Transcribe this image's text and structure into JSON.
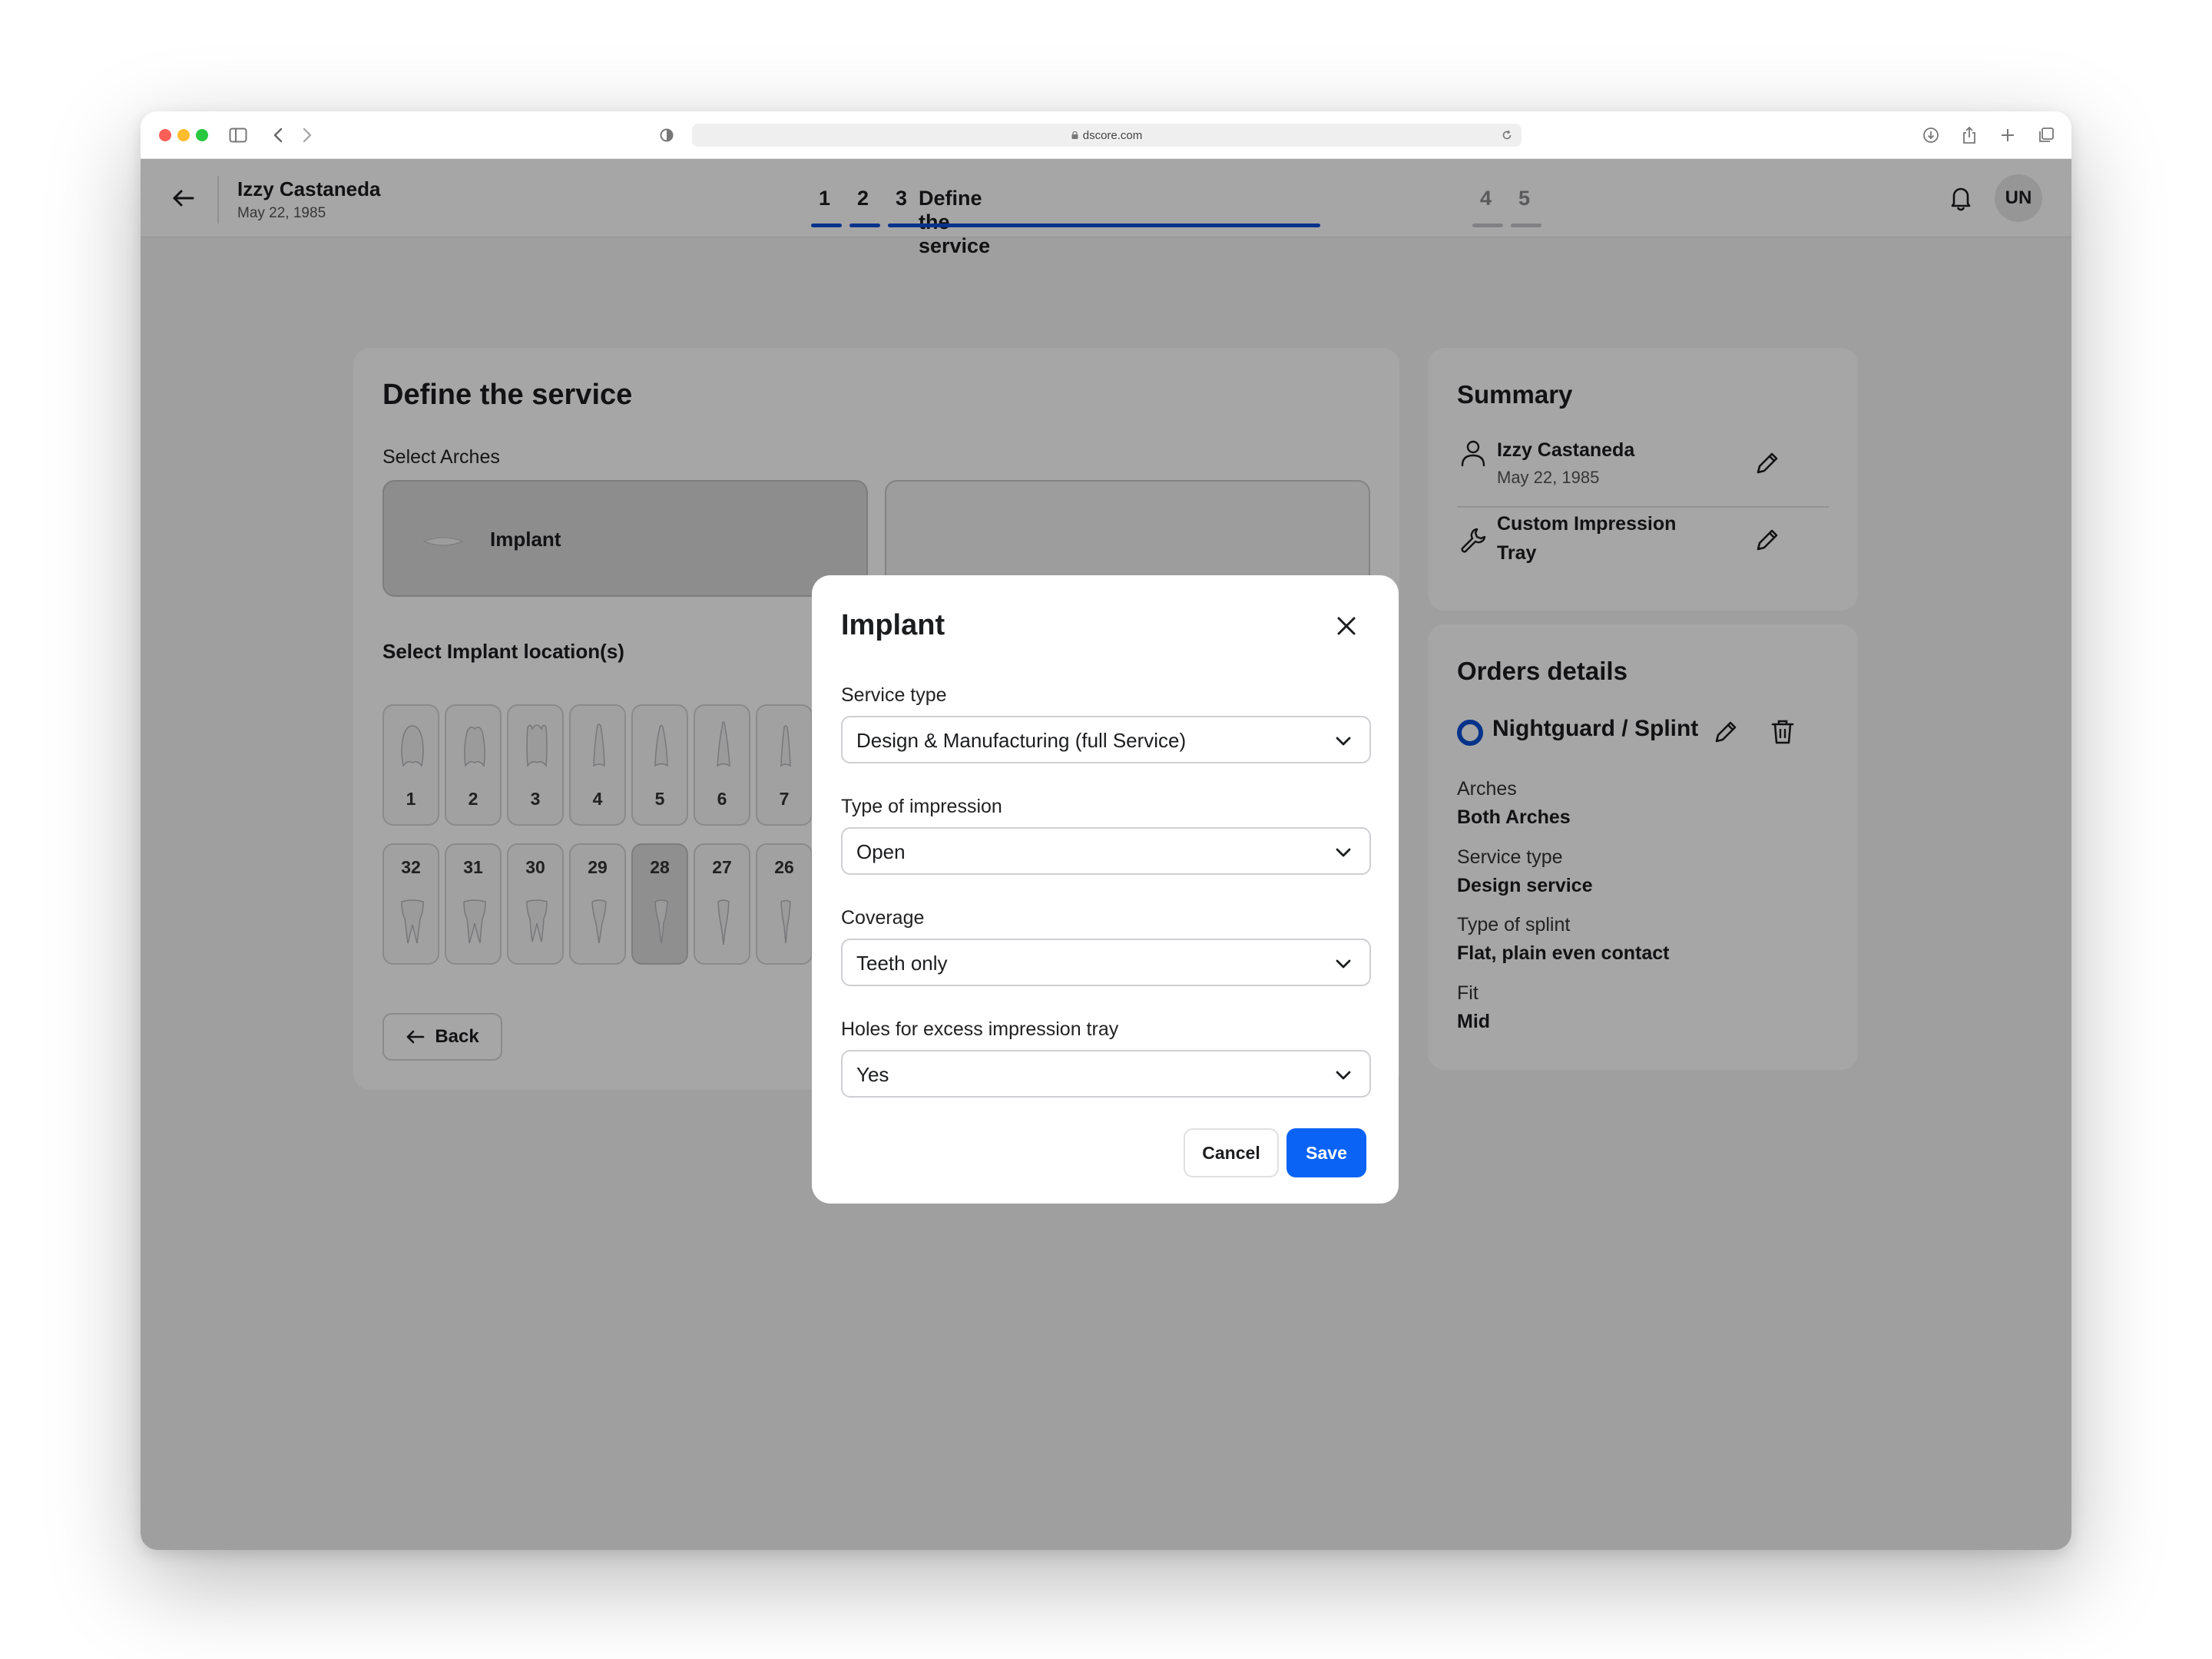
{
  "browser": {
    "url": "dscore.com"
  },
  "header": {
    "patient_name": "Izzy Castaneda",
    "patient_dob": "May 22, 1985",
    "steps": [
      {
        "number": "1",
        "label": "",
        "state": "done"
      },
      {
        "number": "2",
        "label": "",
        "state": "done"
      },
      {
        "number": "3",
        "label": "Define the service",
        "state": "current"
      },
      {
        "number": "4",
        "label": "",
        "state": "upcoming"
      },
      {
        "number": "5",
        "label": "",
        "state": "upcoming"
      }
    ],
    "avatar_initials": "UN"
  },
  "main": {
    "title": "Define the service",
    "select_arches_label": "Select Arches",
    "arches": [
      {
        "label": "Implant",
        "selected": true
      },
      {
        "label": "",
        "selected": false
      }
    ],
    "implant_location_label": "Select Implant location(s)",
    "upper_teeth": [
      "1",
      "2",
      "3",
      "4",
      "5",
      "6",
      "7"
    ],
    "lower_teeth": [
      "32",
      "31",
      "30",
      "29",
      "28",
      "27",
      "26"
    ],
    "selected_tooth": "28",
    "back_label": "Back"
  },
  "summary": {
    "title": "Summary",
    "patient_name": "Izzy Castaneda",
    "patient_dob": "May 22, 1985",
    "product_line1": "Custom Impression",
    "product_line2": "Tray"
  },
  "orders": {
    "title": "Orders details",
    "order_name": "Nightguard / Splint",
    "details": [
      {
        "key": "Arches",
        "value": "Both Arches"
      },
      {
        "key": "Service type",
        "value": "Design service"
      },
      {
        "key": "Type of splint",
        "value": "Flat, plain even contact"
      },
      {
        "key": "Fit",
        "value": "Mid"
      }
    ]
  },
  "modal": {
    "title": "Implant",
    "fields": [
      {
        "label": "Service type",
        "value": "Design & Manufacturing (full Service)"
      },
      {
        "label": "Type of impression",
        "value": "Open"
      },
      {
        "label": "Coverage",
        "value": "Teeth only"
      },
      {
        "label": "Holes for excess impression tray",
        "value": "Yes"
      }
    ],
    "cancel_label": "Cancel",
    "save_label": "Save"
  },
  "colors": {
    "accent": "#0b4fd6",
    "primary_button": "#0b63f6",
    "background": "#f4f4f5"
  }
}
